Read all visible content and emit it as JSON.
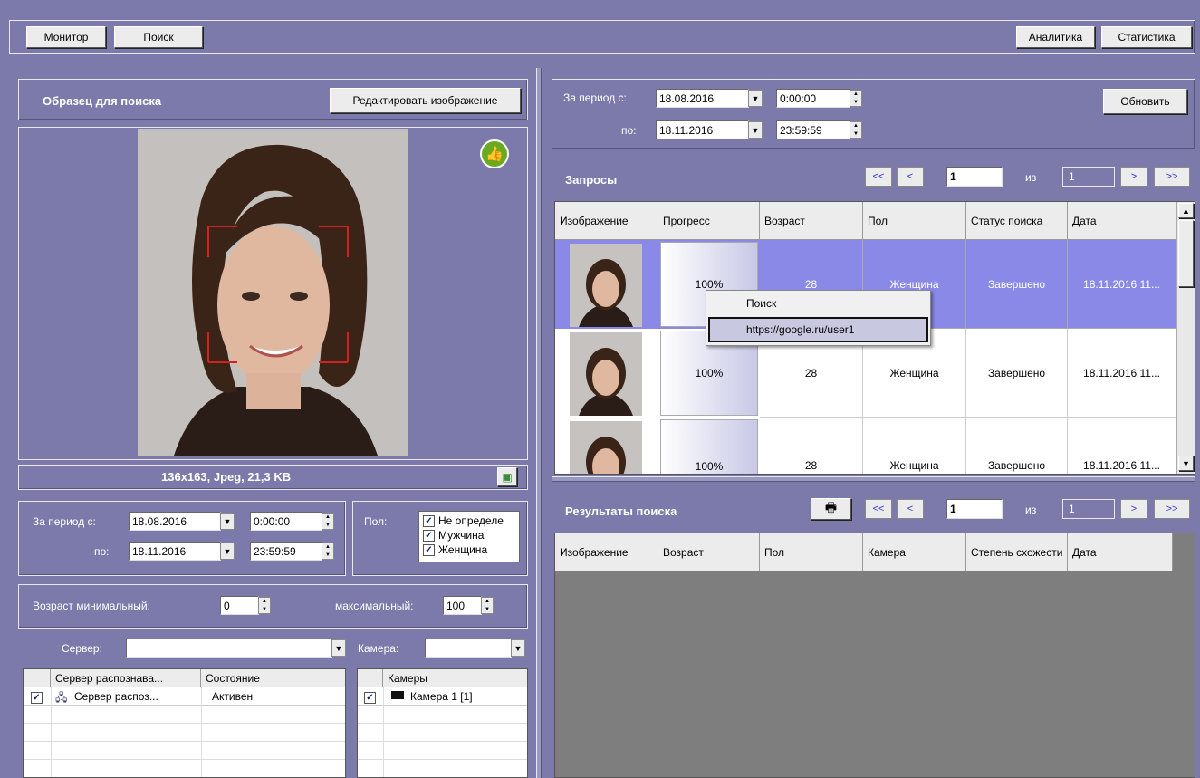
{
  "top_bar": {
    "monitor": "Монитор",
    "search": "Поиск",
    "analytics": "Аналитика",
    "statistics": "Статистика"
  },
  "sample": {
    "title": "Образец для поиска",
    "edit_button": "Редактировать изображение",
    "image_info": "136x163, Jpeg, 21,3 KB"
  },
  "left_filter": {
    "period_from_label": "За период с:",
    "period_to_label": "по:",
    "date_from": "18.08.2016",
    "time_from": "0:00:00",
    "date_to": "18.11.2016",
    "time_to": "23:59:59",
    "gender_label": "Пол:",
    "genders": [
      {
        "label": "Не определе",
        "checked": true
      },
      {
        "label": "Мужчина",
        "checked": true
      },
      {
        "label": "Женщина",
        "checked": true
      }
    ],
    "age_min_label": "Возраст минимальный:",
    "age_min": "0",
    "age_max_label": "максимальный:",
    "age_max": "100",
    "server_label": "Сервер:",
    "server_value": "",
    "camera_label": "Камера:",
    "camera_value": ""
  },
  "server_table": {
    "headers": [
      "Сервер распознава...",
      "Состояние"
    ],
    "rows": [
      {
        "name": "Сервер распоз...",
        "state": "Активен",
        "checked": true
      }
    ]
  },
  "camera_table": {
    "headers": [
      "Камеры"
    ],
    "rows": [
      {
        "name": "Камера 1 [1]",
        "checked": true
      }
    ]
  },
  "right_filter": {
    "period_from_label": "За период с:",
    "period_to_label": "по:",
    "date_from": "18.08.2016",
    "time_from": "0:00:00",
    "date_to": "18.11.2016",
    "time_to": "23:59:59",
    "refresh_button": "Обновить"
  },
  "requests": {
    "title": "Запросы",
    "pager": {
      "first": "<<",
      "prev": "<",
      "page": "1",
      "of_label": "из",
      "total": "1",
      "next": ">",
      "last": ">>"
    },
    "headers": [
      "Изображение",
      "Прогресс",
      "Возраст",
      "Пол",
      "Статус поиска",
      "Дата"
    ],
    "rows": [
      {
        "progress": "100%",
        "age": "28",
        "gender": "Женщина",
        "status": "Завершено",
        "date": "18.11.2016 11...",
        "progress_fraction": 1.0,
        "selected": true
      },
      {
        "progress": "100%",
        "age": "28",
        "gender": "Женщина",
        "status": "Завершено",
        "date": "18.11.2016 11...",
        "progress_fraction": 1.0,
        "selected": false
      },
      {
        "progress": "100%",
        "age": "28",
        "gender": "Женщина",
        "status": "Завершено",
        "date": "18.11.2016 11...",
        "progress_fraction": 1.0,
        "selected": false
      }
    ]
  },
  "context_menu": {
    "items": [
      "Поиск",
      "https://google.ru/user1"
    ]
  },
  "results": {
    "title": "Результаты поиска",
    "pager": {
      "first": "<<",
      "prev": "<",
      "page": "1",
      "of_label": "из",
      "total": "1",
      "next": ">",
      "last": ">>"
    },
    "headers": [
      "Изображение",
      "Возраст",
      "Пол",
      "Камера",
      "Степень схожести",
      "Дата"
    ]
  },
  "colors": {
    "background": "#7b7aab",
    "selected_row": "#8a89e8",
    "frame_red": "#d42020",
    "like_green": "#6aaa20"
  }
}
